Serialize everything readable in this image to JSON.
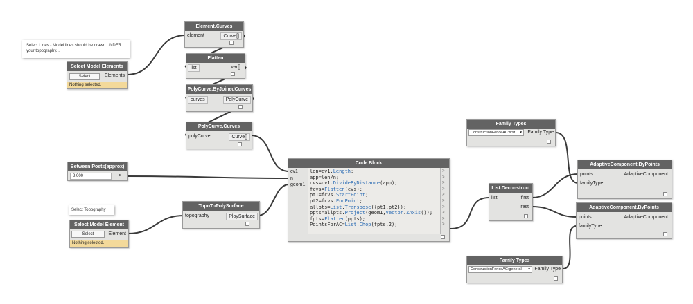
{
  "note1": "Select Lines - Model lines should be drawn UNDER your topography...",
  "note2": "Select Topography",
  "sel1": {
    "title": "Select Model Elements",
    "button": "Select",
    "out": "Elements",
    "status": "Nothing selected."
  },
  "sel2": {
    "title": "Select Model Element",
    "button": "Select",
    "out": "Element",
    "status": "Nothing selected."
  },
  "ec": {
    "title": "Element.Curves",
    "in": "element",
    "out": "Curve[]"
  },
  "fl": {
    "title": "Flatten",
    "in": "list",
    "out": "var[]"
  },
  "pjc": {
    "title": "PolyCurve.ByJoinedCurves",
    "in": "curves",
    "out": "PolyCurve"
  },
  "pcc": {
    "title": "PolyCurve.Curves",
    "in": "polyCurve",
    "out": "Curve[]"
  },
  "bp": {
    "title": "Between Posts(approx)",
    "value": "8.000",
    "arrow": ">"
  },
  "topo": {
    "title": "TopoToPolySurface",
    "in": "topography",
    "out": "PloySurface"
  },
  "cb": {
    "title": "Code Block",
    "inputs": [
      "cv1",
      "n",
      "geom1"
    ],
    "lines": [
      [
        [
          "len=cv1.",
          ""
        ],
        [
          "Length",
          "kw"
        ],
        [
          ";",
          ""
        ]
      ],
      [
        [
          "app=len/n;",
          ""
        ]
      ],
      [
        [
          "cvs=cv1.",
          ""
        ],
        [
          "DivideByDistance",
          "kw"
        ],
        [
          "(app);",
          ""
        ]
      ],
      [
        [
          "fcvs=",
          ""
        ],
        [
          "Flatten",
          "kw"
        ],
        [
          "(cvs);",
          ""
        ]
      ],
      [
        [
          "pt1=fcvs.",
          ""
        ],
        [
          "StartPoint",
          "kw"
        ],
        [
          ";",
          ""
        ]
      ],
      [
        [
          "pt2=fcvs.",
          ""
        ],
        [
          "EndPoint",
          "kw"
        ],
        [
          ";",
          ""
        ]
      ],
      [
        [
          "allpts=",
          ""
        ],
        [
          "List",
          "kw"
        ],
        [
          ".",
          ""
        ],
        [
          "Transpose",
          "kw"
        ],
        [
          "({pt1,pt2});",
          ""
        ]
      ],
      [
        [
          "ppts=allpts.",
          ""
        ],
        [
          "Project",
          "kw"
        ],
        [
          "(geom1,",
          ""
        ],
        [
          "Vector",
          "kw"
        ],
        [
          ".",
          ""
        ],
        [
          "ZAxis",
          "kw"
        ],
        [
          "());",
          ""
        ]
      ],
      [
        [
          "fpts=",
          ""
        ],
        [
          "Flatten",
          "kw"
        ],
        [
          "(ppts);",
          ""
        ]
      ],
      [
        [
          "PointsForAC=",
          ""
        ],
        [
          "List",
          "kw"
        ],
        [
          ".",
          ""
        ],
        [
          "Chop",
          "kw"
        ],
        [
          "(fpts,2);",
          ""
        ]
      ]
    ]
  },
  "ft1": {
    "title": "Family Types",
    "value": "ConstructionFenceAC:first",
    "out": "Family Type"
  },
  "ft2": {
    "title": "Family Types",
    "value": "ConstructionFenceAC:general",
    "out": "Family Type"
  },
  "ld": {
    "title": "List.Deconstruct",
    "in": "list",
    "out1": "first",
    "out2": "rest"
  },
  "ac1": {
    "title": "AdaptiveComponent.ByPoints",
    "in1": "points",
    "in2": "familyType",
    "out": "AdaptiveComponent"
  },
  "ac2": {
    "title": "AdaptiveComponent.ByPoints",
    "in1": "points",
    "in2": "familyType",
    "out": "AdaptiveComponent"
  },
  "colors": {
    "header": "#636363",
    "body": "#e3e3e1",
    "wire": "#3a3a3a",
    "warn": "#f3d99a"
  }
}
